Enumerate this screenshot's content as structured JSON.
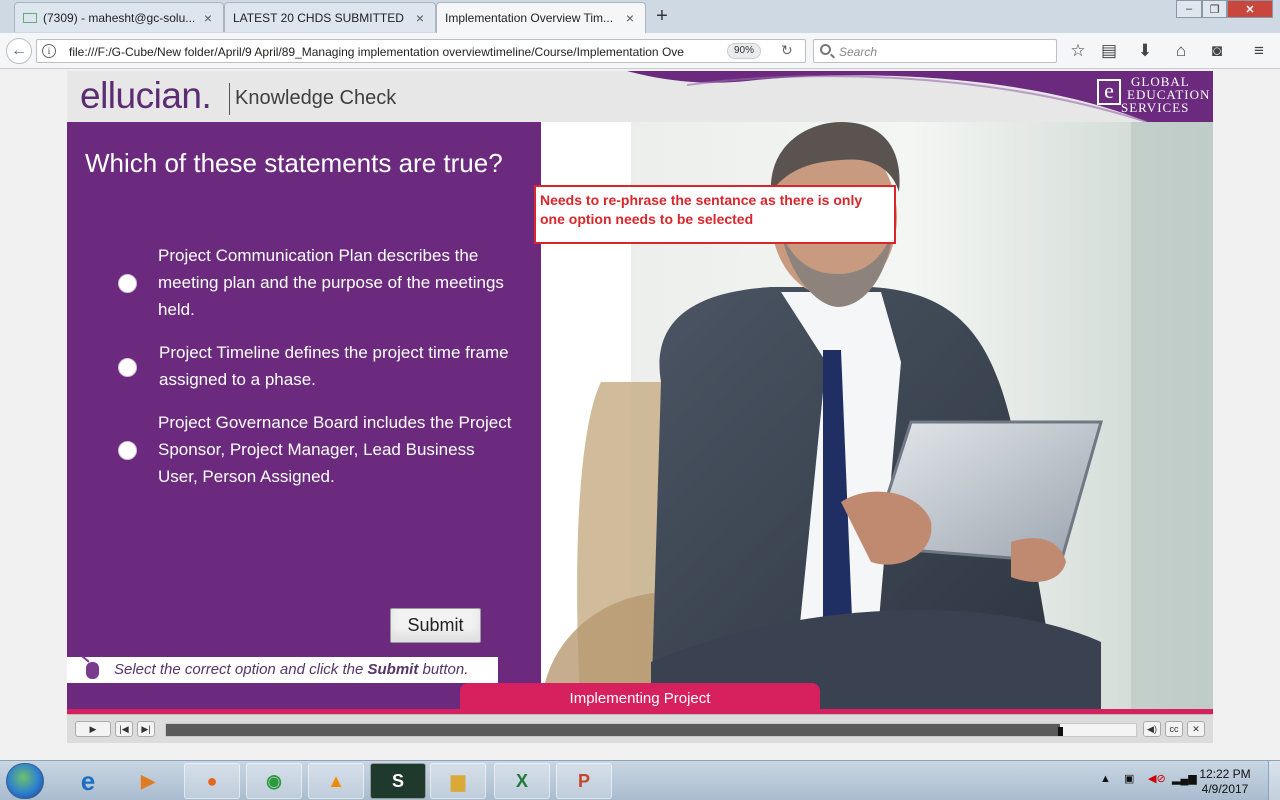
{
  "browser": {
    "tabs": [
      {
        "label": "(7309) - mahesht@gc-solu...",
        "active": false
      },
      {
        "label": "LATEST 20 CHDS SUBMITTED ...",
        "active": false
      },
      {
        "label": "Implementation Overview Tim...",
        "active": true
      }
    ],
    "new_tab_label": "+",
    "window_buttons": {
      "minimize": "–",
      "restore": "❐",
      "close": "✕"
    },
    "url": "file:///F:/G-Cube/New folder/April/9 April/89_Managing implementation overviewtimeline/Course/Implementation Ove",
    "zoom": "90%",
    "search_placeholder": "Search"
  },
  "course": {
    "logo": "ellucian.",
    "header_title": "Knowledge Check",
    "brand_logo": {
      "letter": "e",
      "line1": "GLOBAL",
      "line2": "EDUCATION",
      "line3": "SERVICES"
    },
    "question": "Which of these statements are true?",
    "options": [
      {
        "text": "Project Communication Plan describes the meeting plan and the purpose of the meetings held."
      },
      {
        "text": "Project Timeline defines the project time frame assigned to a phase."
      },
      {
        "text": "Project Governance Board includes the Project Sponsor, Project Manager, Lead Business User, Person Assigned."
      }
    ],
    "submit_label": "Submit",
    "instruction_prefix": "Select the correct option and click the ",
    "instruction_bold": "Submit",
    "instruction_suffix": " button.",
    "review_note": "Needs to re-phrase the sentance as there is only one option needs to be selected",
    "footer_title": "Implementing Project",
    "accent_color": "#6b2a7e",
    "footer_color": "#d6215e"
  },
  "player": {
    "progress": 0.922
  },
  "taskbar": {
    "apps": [
      "internet-explorer",
      "media-player",
      "firefox",
      "chrome",
      "vlc",
      "s-app",
      "file-explorer",
      "excel",
      "powerpoint"
    ],
    "clock_time": "12:22 PM",
    "clock_date": "4/9/2017"
  }
}
